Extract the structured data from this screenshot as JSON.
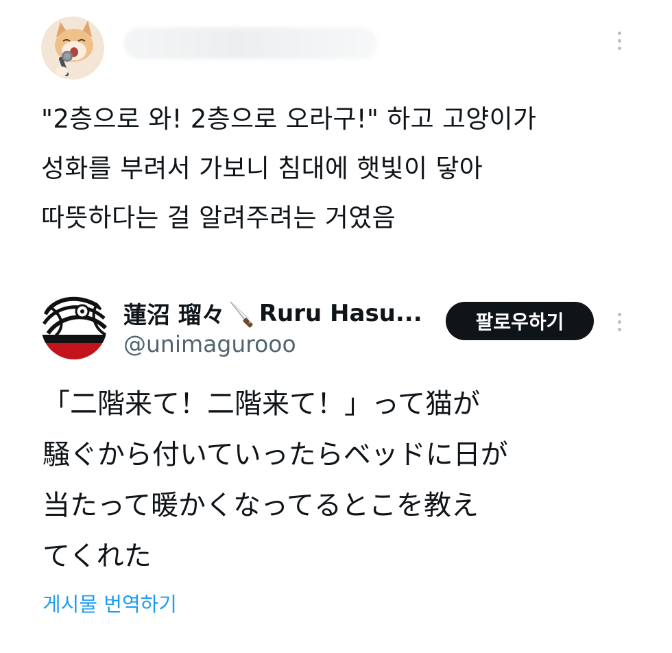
{
  "post": {
    "text_lines": [
      "\"2층으로 와! 2층으로 오라구!\" 하고 고양이가",
      "성화를 부려서 가보니 침대에 햇빛이 닿아",
      "따뜻하다는 걸 알려주려는 거였음"
    ],
    "avatar_icon": "cat-singing-avatar"
  },
  "quoted": {
    "display_name": "蓮沼 瑠々",
    "display_name_suffix": "Ruru Hasu...",
    "name_emoji_icon": "knife-icon",
    "handle": "@unimagurooo",
    "follow_label": "팔로우하기",
    "text_lines": [
      "「二階来て！二階来て！」って猫が",
      "騒ぐから付いていったらベッドに日が",
      "当たって暖かくなってるとこを教え",
      "てくれた"
    ],
    "translate_label": "게시물 번역하기"
  },
  "colors": {
    "text": "#0f1419",
    "secondary": "#536471",
    "link": "#1d9bf0",
    "button": "#0f1419"
  }
}
